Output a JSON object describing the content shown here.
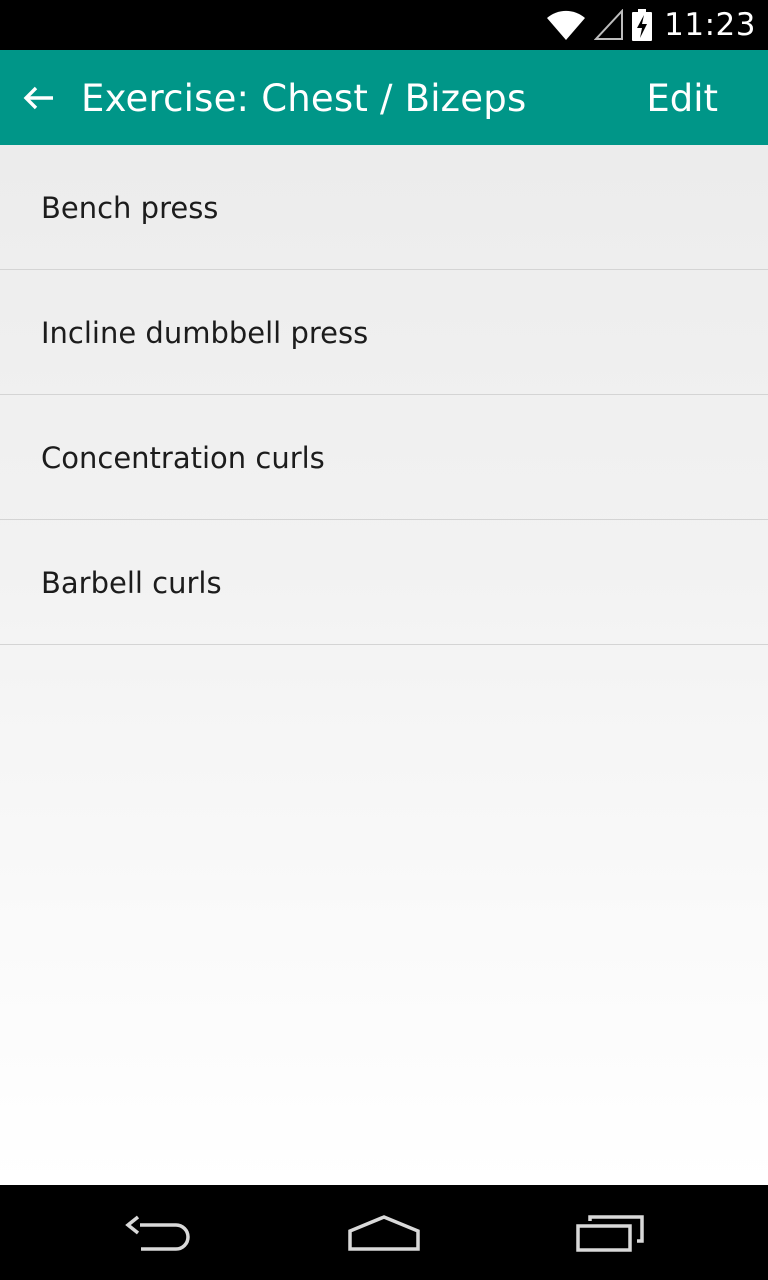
{
  "status_bar": {
    "time": "11:23",
    "icons": [
      "wifi-icon",
      "cell-signal-icon",
      "battery-charging-icon"
    ]
  },
  "action_bar": {
    "back_icon": "arrow-left-icon",
    "title": "Exercise: Chest / Bizeps",
    "edit_label": "Edit",
    "color": "#009688"
  },
  "exercises": [
    {
      "label": "Bench press"
    },
    {
      "label": "Incline dumbbell press"
    },
    {
      "label": "Concentration curls"
    },
    {
      "label": "Barbell curls"
    }
  ],
  "nav_bar": {
    "icons": [
      "nav-back-icon",
      "nav-home-icon",
      "nav-recents-icon"
    ]
  }
}
